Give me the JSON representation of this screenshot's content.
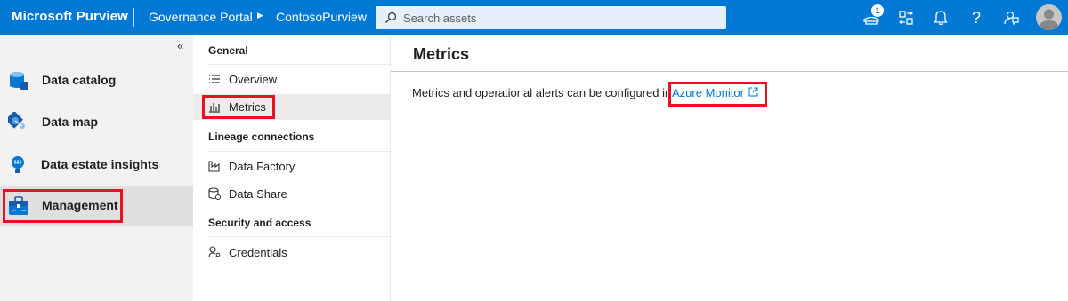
{
  "header": {
    "brand": "Microsoft Purview",
    "portal": "Governance Portal",
    "account": "ContosoPurview",
    "search_placeholder": "Search assets",
    "notification_count": "1",
    "bar_color": "#0078d4",
    "icons": [
      "notifications-icon",
      "directory-switch-icon",
      "bell-icon",
      "help-icon",
      "feedback-icon",
      "user-avatar"
    ]
  },
  "leftnav": {
    "collapse_glyph": "«",
    "items": [
      {
        "label": "Data catalog",
        "icon": "data-catalog-icon"
      },
      {
        "label": "Data map",
        "icon": "data-map-icon"
      },
      {
        "label": "Data estate insights",
        "icon": "insights-icon"
      },
      {
        "label": "Management",
        "icon": "management-icon",
        "active": true
      }
    ]
  },
  "subnav": {
    "sections": [
      {
        "title": "General",
        "items": [
          {
            "label": "Overview",
            "icon": "list-icon"
          },
          {
            "label": "Metrics",
            "icon": "metrics-icon",
            "active": true
          }
        ]
      },
      {
        "title": "Lineage connections",
        "items": [
          {
            "label": "Data Factory",
            "icon": "data-factory-icon"
          },
          {
            "label": "Data Share",
            "icon": "data-share-icon"
          }
        ]
      },
      {
        "title": "Security and access",
        "items": [
          {
            "label": "Credentials",
            "icon": "credentials-icon"
          }
        ]
      }
    ]
  },
  "main": {
    "title": "Metrics",
    "description": "Metrics and operational alerts can be configured in ",
    "link_text": "Azure Monitor",
    "link_color": "#0078d4",
    "highlight_color": "#e81123"
  }
}
